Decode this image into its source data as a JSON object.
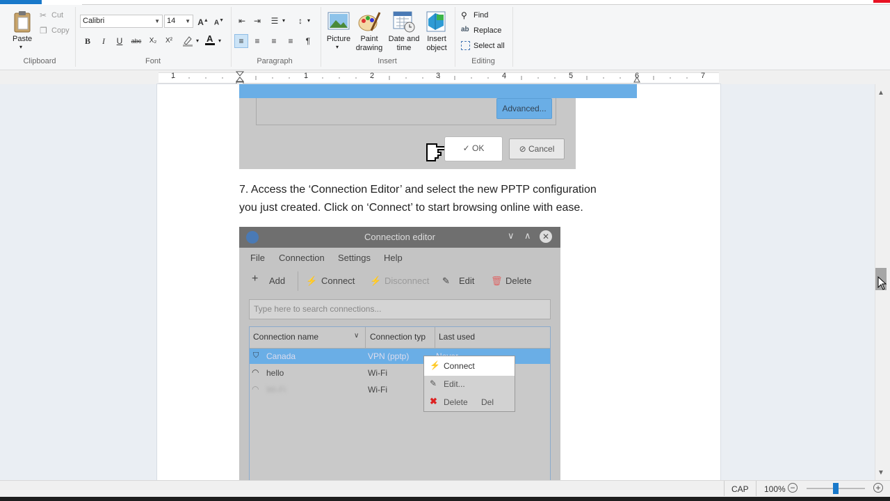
{
  "ribbon": {
    "clipboard": {
      "paste": "Paste",
      "cut": "Cut",
      "copy": "Copy",
      "label": "Clipboard"
    },
    "font": {
      "family": "Calibri",
      "size": "14",
      "label": "Font",
      "bold": "B",
      "italic": "I",
      "underline": "U",
      "strike": "abc",
      "sub": "X₂",
      "sup": "X²"
    },
    "paragraph": {
      "label": "Paragraph"
    },
    "insert": {
      "picture": "Picture",
      "paint_1": "Paint",
      "paint_2": "drawing",
      "date_1": "Date and",
      "date_2": "time",
      "object_1": "Insert",
      "object_2": "object",
      "label": "Insert"
    },
    "editing": {
      "find": "Find",
      "replace": "Replace",
      "select_all": "Select all",
      "label": "Editing"
    }
  },
  "ruler": {
    "numbers": [
      "1",
      "1",
      "2",
      "3",
      "4",
      "5",
      "6",
      "7"
    ]
  },
  "document": {
    "shot1": {
      "advanced": "Advanced...",
      "ok": "OK",
      "cancel": "Cancel"
    },
    "paragraph_line1": "7. Access the ‘Connection Editor’ and select the new PPTP configuration",
    "paragraph_line2": "you just created. Click on ‘Connect’ to start browsing online with ease.",
    "shot2": {
      "title": "Connection editor",
      "menu": [
        "File",
        "Connection",
        "Settings",
        "Help"
      ],
      "toolbar": {
        "add": "Add",
        "connect": "Connect",
        "disconnect": "Disconnect",
        "edit": "Edit",
        "delete": "Delete"
      },
      "search_placeholder": "Type here to search connections...",
      "columns": [
        "Connection name",
        "Connection typ",
        "Last used"
      ],
      "rows": [
        {
          "name": "Canada",
          "type": "VPN (pptp)",
          "last": "Never"
        },
        {
          "name": "hello",
          "type": "Wi-Fi",
          "last": ""
        },
        {
          "name": "Wi-Fi",
          "type": "Wi-Fi",
          "last": ""
        }
      ],
      "context_menu": {
        "connect": "Connect",
        "edit": "Edit...",
        "delete": "Delete",
        "delete_shortcut": "Del"
      }
    }
  },
  "status": {
    "caps": "CAP",
    "zoom": "100%",
    "zoom_level_percent": 100
  },
  "colors": {
    "accent": "#1979ca",
    "selection": "#6aaee6",
    "delete_red": "#d22"
  }
}
